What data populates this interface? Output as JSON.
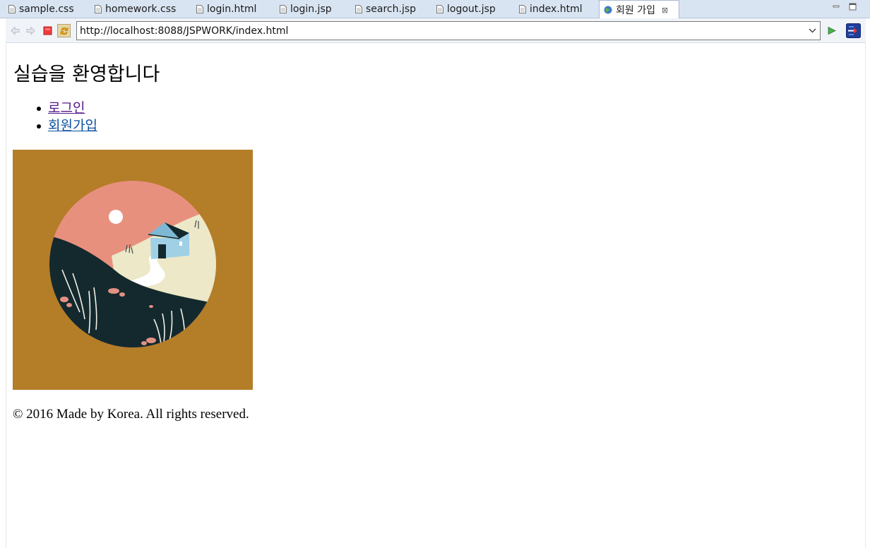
{
  "tabs": [
    {
      "label": "sample.css",
      "icon": "file-icon",
      "active": false
    },
    {
      "label": "homework.css",
      "icon": "file-icon",
      "active": false
    },
    {
      "label": "login.html",
      "icon": "file-icon",
      "active": false
    },
    {
      "label": "login.jsp",
      "icon": "file-icon",
      "active": false
    },
    {
      "label": "search.jsp",
      "icon": "file-icon",
      "active": false
    },
    {
      "label": "logout.jsp",
      "icon": "file-icon",
      "active": false
    },
    {
      "label": "index.html",
      "icon": "file-icon",
      "active": false
    },
    {
      "label": "회원 가입",
      "icon": "globe-icon",
      "active": true
    }
  ],
  "toolbar": {
    "url": "http://localhost:8088/JSPWORK/index.html"
  },
  "page": {
    "title": "실습을 환영합니다",
    "nav": [
      {
        "label": "로그인",
        "state": "visited"
      },
      {
        "label": "회원가입",
        "state": "unvisited"
      }
    ],
    "footer": "© 2016 Made by Korea. All rights reserved."
  },
  "colors": {
    "tabbar_bg": "#d8e4f2",
    "visited_link": "#551a8b",
    "unvisited_link": "#0b4fa0",
    "illustration_bg": "#b47d28",
    "sky": "#e8907e",
    "hill_dark": "#13292e",
    "field": "#ece8c8",
    "house": "#9fd0e6"
  }
}
